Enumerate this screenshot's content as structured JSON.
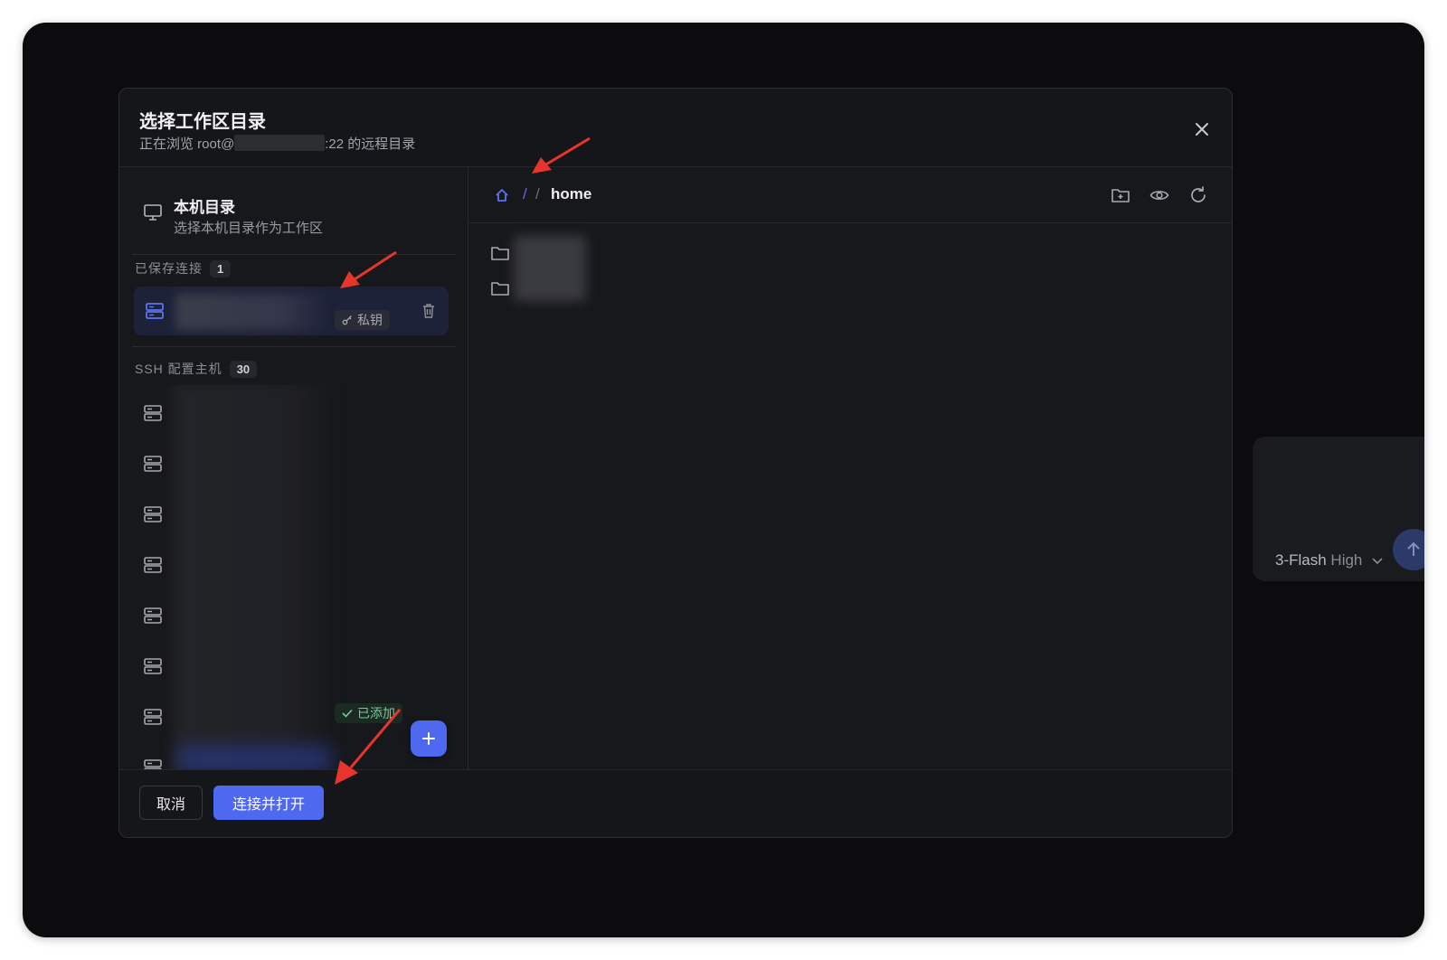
{
  "dialog": {
    "title": "选择工作区目录",
    "subtitle_prefix": "正在浏览 root@",
    "subtitle_suffix": ":22 的远程目录"
  },
  "local": {
    "title": "本机目录",
    "description": "选择本机目录作为工作区"
  },
  "saved": {
    "label": "已保存连接",
    "count": "1",
    "items": [
      {
        "auth_tag": "私钥"
      }
    ]
  },
  "ssh_hosts": {
    "label": "SSH 配置主机",
    "count": "30",
    "added_badge": "已添加"
  },
  "breadcrumb": {
    "root_sep": "/",
    "sep": "/",
    "current": "home"
  },
  "footer": {
    "cancel_label": "取消",
    "confirm_label": "连接并打开"
  },
  "background": {
    "model_prefix": "3-Flash",
    "model_level": "High"
  },
  "colors": {
    "accent": "#4f68f0",
    "annotation_arrow": "#e8352b",
    "success": "#7ac997"
  }
}
